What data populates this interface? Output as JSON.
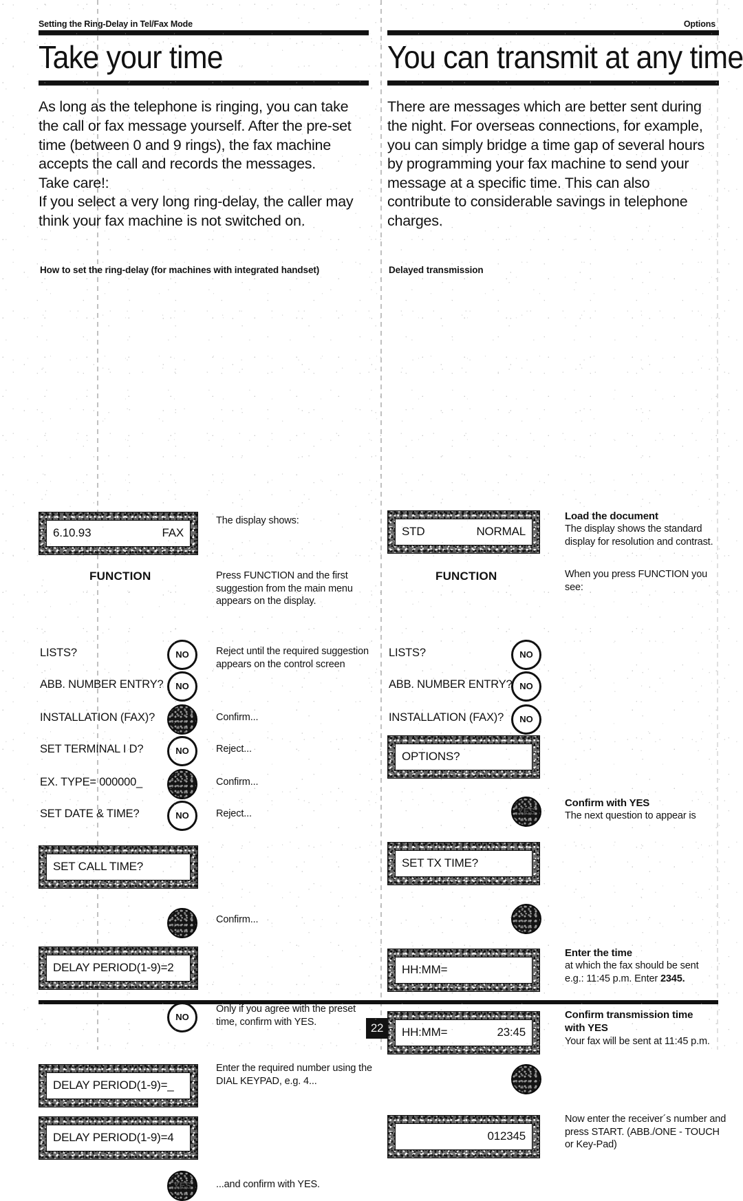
{
  "running_head": {
    "left": "Setting the Ring-Delay in Tel/Fax Mode",
    "right": "Options"
  },
  "left_column": {
    "headline": "Take your time",
    "intro_lines": [
      "As long as the telephone is ringing, you can take",
      "the call or fax message yourself. After the pre-set",
      "time (between 0 and 9 rings), the fax machine",
      "accepts the call and records the messages.",
      "Take care!:",
      "If you select a very long ring-delay, the caller may",
      "think your fax machine is not switched on."
    ],
    "subhead": "How to set the ring-delay (for machines with integrated handset)",
    "lcd_1": {
      "left": "6.10.93",
      "right": "FAX"
    },
    "note_display_shows": "The display shows:",
    "function_label": "FUNCTION",
    "note_function": "Press FUNCTION and the first suggestion from the main menu appears on the display.",
    "menu": [
      {
        "label": "LISTS?",
        "key": "NO"
      },
      {
        "label": "ABB. NUMBER ENTRY?",
        "key": "NO"
      },
      {
        "label": "INSTALLATION (FAX)?",
        "key": "YES"
      },
      {
        "label": "SET TERMINAL I D?",
        "key": "NO"
      },
      {
        "label": "EX. TYPE= 000000_",
        "key": "YES"
      },
      {
        "label": "SET DATE & TIME?",
        "key": "NO"
      }
    ],
    "note_reject": "Reject until the required suggestion appears on the control screen",
    "note_confirm_1": "Confirm...",
    "note_reject_1": "Reject...",
    "note_confirm_2": "Confirm...",
    "note_reject_2": "Reject...",
    "lcd_2": {
      "left": "SET CALL TIME?",
      "right": ""
    },
    "key_confirm_label": "YES",
    "note_confirm_3": "Confirm...",
    "lcd_3": {
      "left": "DELAY PERIOD(1-9)=2",
      "right": ""
    },
    "key_no_label": "NO",
    "note_preset": "Only if you agree with the preset time, confirm with YES.",
    "lcd_4": {
      "left": "DELAY PERIOD(1-9)=_",
      "right": ""
    },
    "note_enter_number": "Enter the required number using the DIAL KEYPAD, e.g. 4...",
    "lcd_5": {
      "left": "DELAY PERIOD(1-9)=4",
      "right": ""
    },
    "note_final": "...and confirm with YES."
  },
  "right_column": {
    "headline": "You can transmit at any time",
    "intro_lines": [
      "There are messages which are better sent during",
      "the night. For overseas connections, for example,",
      "you can simply bridge a time gap of several hours",
      "by programming your fax machine to send your",
      "message at a specific time. This can also",
      "contribute to considerable savings in telephone",
      "charges."
    ],
    "subhead": "Delayed transmission",
    "lcd_1": {
      "left": "STD",
      "right": "NORMAL"
    },
    "note_load_head": "Load the document",
    "note_load_body": "The display shows the standard display for resolution and contrast.",
    "function_label": "FUNCTION",
    "note_function": "When you press FUNCTION you see:",
    "menu": [
      {
        "label": "LISTS?",
        "key": "NO"
      },
      {
        "label": "ABB. NUMBER ENTRY?",
        "key": "NO"
      },
      {
        "label": "INSTALLATION (FAX)?",
        "key": "NO"
      }
    ],
    "lcd_2": {
      "left": "OPTIONS?",
      "right": ""
    },
    "key_yes_label": "YES",
    "note_confirm_head": "Confirm with YES",
    "note_confirm_body": "The next question to appear is",
    "lcd_3": {
      "left": "SET TX TIME?",
      "right": ""
    },
    "lcd_4": {
      "left": "HH:MM=",
      "right": ""
    },
    "note_enter_time_head": "Enter the time",
    "note_enter_time_body": "at which the fax should be sent",
    "note_enter_time_eg_pre": "e.g.: 11:45 p.m. Enter ",
    "note_enter_time_eg_bold": "2345.",
    "lcd_5": {
      "left": "HH:MM=",
      "right": "23:45"
    },
    "note_confirm_tx_head_1": "Confirm transmission time",
    "note_confirm_tx_head_2": "with YES",
    "note_confirm_tx_body": "Your fax will be sent at 11:45 p.m.",
    "lcd_6": {
      "left": "",
      "right": "012345"
    },
    "note_receiver": "Now enter the receiver´s number and press START. (ABB./ONE - TOUCH or Key-Pad)"
  },
  "footer": {
    "page_number": "22"
  }
}
